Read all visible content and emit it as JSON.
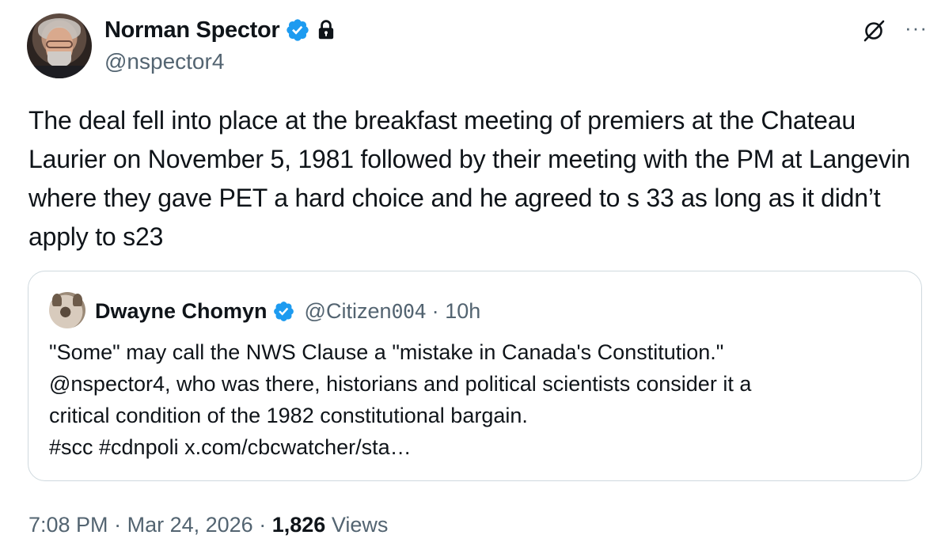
{
  "author": {
    "display_name": "Norman Spector",
    "handle": "@nspector4",
    "verified_color": "#1d9bf0",
    "badges": [
      "verified-badge-icon",
      "lock-icon"
    ]
  },
  "actions": {
    "grok_icon": "grok-icon",
    "more_label": "···"
  },
  "tweet": {
    "text": "The deal fell into place at the breakfast meeting of premiers at the Chateau Laurier on November 5, 1981 followed by their meeting with the PM at Langevin where they gave PET a hard choice and he agreed to s 33 as long as it didn’t apply to s23"
  },
  "quote": {
    "display_name": "Dwayne Chomyn",
    "handle_prefix": "@Citizen",
    "handle_digits": "004",
    "separator": "·",
    "time": "10h",
    "text_line1": "\"Some\" may call the NWS Clause a \"mistake in Canada's Constitution.\"",
    "text_line2": "@nspector4, who was there, historians and political scientists consider it a",
    "text_line3": "critical condition of the 1982 constitutional bargain.",
    "text_line4": "#scc #cdnpoli x.com/cbcwatcher/sta…"
  },
  "meta": {
    "time": "7:08 PM",
    "separator": "·",
    "date": "Mar 24, 2026",
    "views_count": "1,826",
    "views_label": "Views"
  }
}
